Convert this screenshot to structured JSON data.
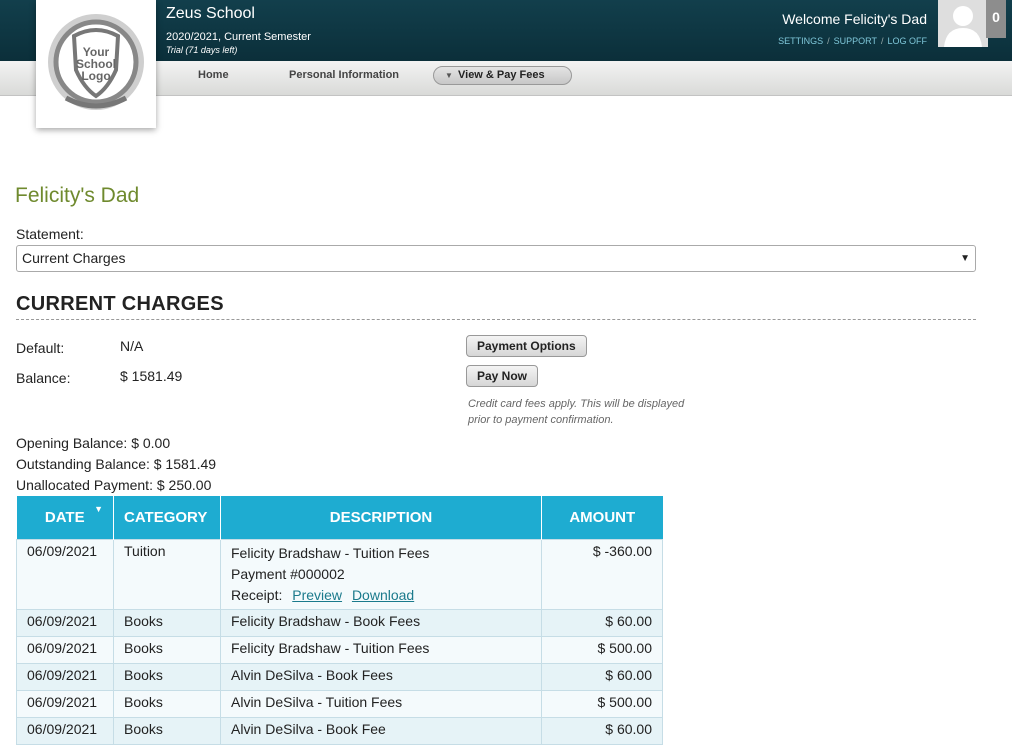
{
  "header": {
    "school_name": "Zeus School",
    "semester": "2020/2021, Current Semester",
    "trial": "Trial (71 days left)",
    "logo_text": "Your School Logo",
    "welcome": "Welcome Felicity's Dad",
    "links": {
      "settings": "SETTINGS",
      "support": "SUPPORT",
      "logoff": "LOG OFF",
      "sep": "/"
    },
    "notification_count": "0"
  },
  "nav": {
    "home": "Home",
    "personal": "Personal Information",
    "fees": "View & Pay Fees"
  },
  "main": {
    "user_name": "Felicity's Dad",
    "statement_label": "Statement:",
    "statement_value": "Current Charges",
    "section_title": "CURRENT CHARGES",
    "default_label": "Default:",
    "default_value": "N/A",
    "balance_label": "Balance:",
    "balance_value": "$ 1581.49",
    "payment_options_button": "Payment Options",
    "pay_now_button": "Pay Now",
    "note": "Credit card fees apply. This will be displayed prior to payment confirmation.",
    "opening_balance": "Opening Balance: $ 0.00",
    "outstanding_balance": "Outstanding Balance: $ 1581.49",
    "unallocated_payment": "Unallocated Payment: $ 250.00"
  },
  "table": {
    "headers": {
      "date": "DATE",
      "category": "CATEGORY",
      "description": "DESCRIPTION",
      "amount": "AMOUNT"
    },
    "receipt_label": "Receipt:",
    "preview": "Preview",
    "download": "Download",
    "rows": [
      {
        "date": "06/09/2021",
        "category": "Tuition",
        "description": "Felicity Bradshaw - Tuition Fees",
        "payment": "Payment #000002",
        "amount": "$ -360.00"
      },
      {
        "date": "06/09/2021",
        "category": "Books",
        "description": "Felicity Bradshaw - Book Fees",
        "amount": "$ 60.00"
      },
      {
        "date": "06/09/2021",
        "category": "Books",
        "description": "Felicity Bradshaw - Tuition Fees",
        "amount": "$ 500.00"
      },
      {
        "date": "06/09/2021",
        "category": "Books",
        "description": "Alvin DeSilva - Book Fees",
        "amount": "$ 60.00"
      },
      {
        "date": "06/09/2021",
        "category": "Books",
        "description": "Alvin DeSilva - Tuition Fees",
        "amount": "$ 500.00"
      },
      {
        "date": "06/09/2021",
        "category": "Books",
        "description": "Alvin DeSilva - Book Fee",
        "amount": "$ 60.00"
      }
    ]
  },
  "colors": {
    "header_bg": "#0b2f3a",
    "accent_green": "#6f8a2e",
    "table_header": "#1eacd1"
  }
}
